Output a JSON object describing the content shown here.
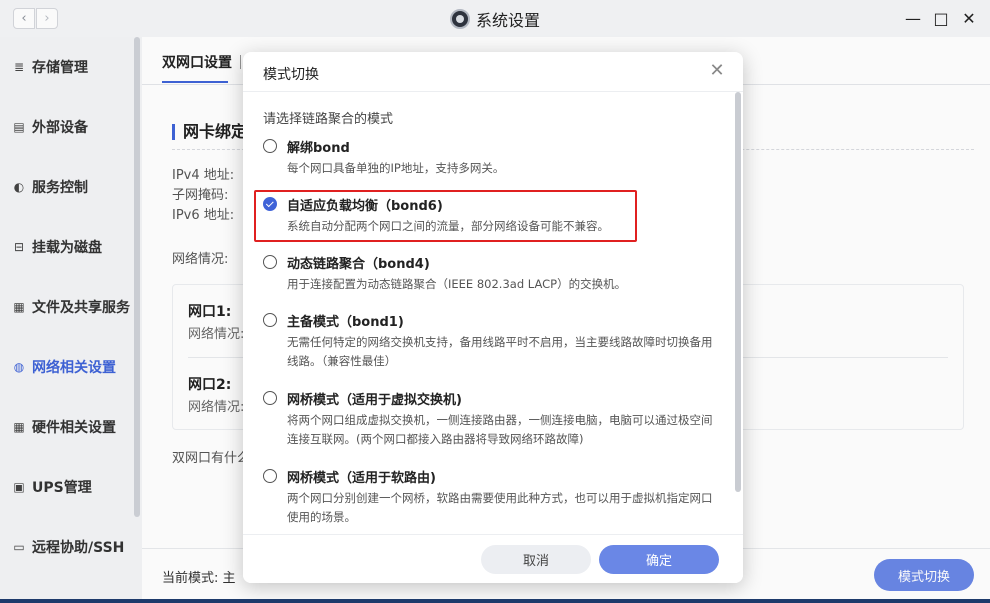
{
  "window": {
    "title": "系统设置",
    "back": "‹",
    "forward": "›",
    "minimize": "—",
    "maximize": "□",
    "close": "✕"
  },
  "sidebar": {
    "items": [
      {
        "label": "存储管理",
        "icon": "database-icon",
        "glyph": "≣"
      },
      {
        "label": "外部设备",
        "icon": "device-icon",
        "glyph": "▤"
      },
      {
        "label": "服务控制",
        "icon": "toggle-icon",
        "glyph": "◐"
      },
      {
        "label": "挂载为磁盘",
        "icon": "disk-icon",
        "glyph": "⊟"
      },
      {
        "label": "文件及共享服务",
        "icon": "file-share-icon",
        "glyph": "▦"
      },
      {
        "label": "网络相关设置",
        "icon": "globe-icon",
        "glyph": "◍"
      },
      {
        "label": "硬件相关设置",
        "icon": "grid-icon",
        "glyph": "▦"
      },
      {
        "label": "UPS管理",
        "icon": "ups-icon",
        "glyph": "▣"
      },
      {
        "label": "远程协助/SSH",
        "icon": "remote-icon",
        "glyph": "▭"
      }
    ],
    "active_index": 5
  },
  "main": {
    "tab": "双网口设置",
    "section_title": "网卡绑定",
    "ipv4_label": "IPv4 地址:",
    "subnet_label": "子网掩码:",
    "ipv6_label": "IPv6 地址:",
    "network_label": "网络情况:",
    "port1_title": "网口1:",
    "port1_status": "网络情况:",
    "port2_title": "网口2:",
    "port2_status": "网络情况:",
    "faq": "双网口有什么",
    "current_mode": "当前模式: 主",
    "mode_switch_button": "模式切换"
  },
  "modal": {
    "title": "模式切换",
    "close": "✕",
    "prompt": "请选择链路聚合的模式",
    "options": [
      {
        "title": "解绑bond",
        "desc": "每个网口具备单独的IP地址，支持多网关。",
        "checked": false
      },
      {
        "title": "自适应负载均衡（bond6)",
        "desc": "系统自动分配两个网口之间的流量，部分网络设备可能不兼容。",
        "checked": true
      },
      {
        "title": "动态链路聚合（bond4)",
        "desc": "用于连接配置为动态链路聚合（IEEE 802.3ad LACP）的交换机。",
        "checked": false
      },
      {
        "title": "主备模式（bond1)",
        "desc": "无需任何特定的网络交换机支持，备用线路平时不启用，当主要线路故障时切换备用线路。（兼容性最佳）",
        "checked": false
      },
      {
        "title": "网桥模式（适用于虚拟交换机)",
        "desc": "将两个网口组成虚拟交换机，一侧连接路由器，一侧连接电脑，电脑可以通过极空间连接互联网。(两个网口都接入路由器将导致网络环路故障)",
        "checked": false
      },
      {
        "title": "网桥模式（适用于软路由)",
        "desc": "两个网口分别创建一个网桥，软路由需要使用此种方式，也可以用于虚拟机指定网口使用的场景。",
        "checked": false
      }
    ],
    "cancel": "取消",
    "confirm": "确定"
  },
  "colors": {
    "accent": "#3f63d8",
    "button": "#6a87e6",
    "highlight": "#e02020"
  }
}
